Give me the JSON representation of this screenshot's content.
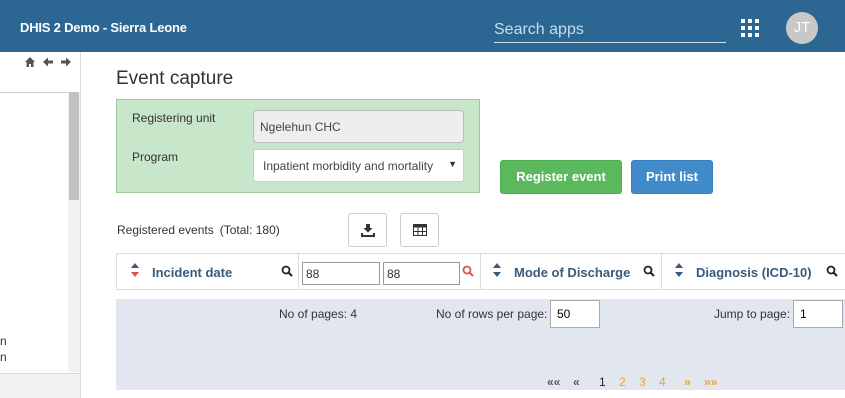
{
  "header": {
    "app_title": "DHIS 2 Demo - Sierra Leone",
    "search_placeholder": "Search apps",
    "apps_icon": "apps-grid-icon",
    "avatar_initials": "JT",
    "color": "#2c6693"
  },
  "sidebar": {
    "nav_icons": [
      "home-icon",
      "arrow-left-icon",
      "arrow-right-icon"
    ],
    "tree_items": [
      "n",
      "n"
    ]
  },
  "main": {
    "page_title": "Event capture",
    "form": {
      "registering_unit_label": "Registering unit",
      "registering_unit_value": "Ngelehun CHC",
      "program_label": "Program",
      "program_value": "Inpatient morbidity and mortality"
    },
    "buttons": {
      "register": "Register event",
      "print": "Print list"
    },
    "events": {
      "label": "Registered events",
      "total": "(Total: 180)"
    },
    "table": {
      "columns": [
        {
          "label": "Incident date"
        },
        {
          "label": "Mode of Discharge"
        },
        {
          "label": "Diagnosis (ICD-10)"
        }
      ],
      "filter_from": "88",
      "filter_to": "88"
    },
    "paging": {
      "pages_text": "No of pages: 4",
      "rows_label": "No of rows per page:",
      "rows_value": "50",
      "jump_label": "Jump to page:",
      "jump_value": "1",
      "first": "««",
      "prev": "«",
      "pages": [
        "1",
        "2",
        "3",
        "4"
      ],
      "next": "»",
      "last": "»»"
    }
  }
}
